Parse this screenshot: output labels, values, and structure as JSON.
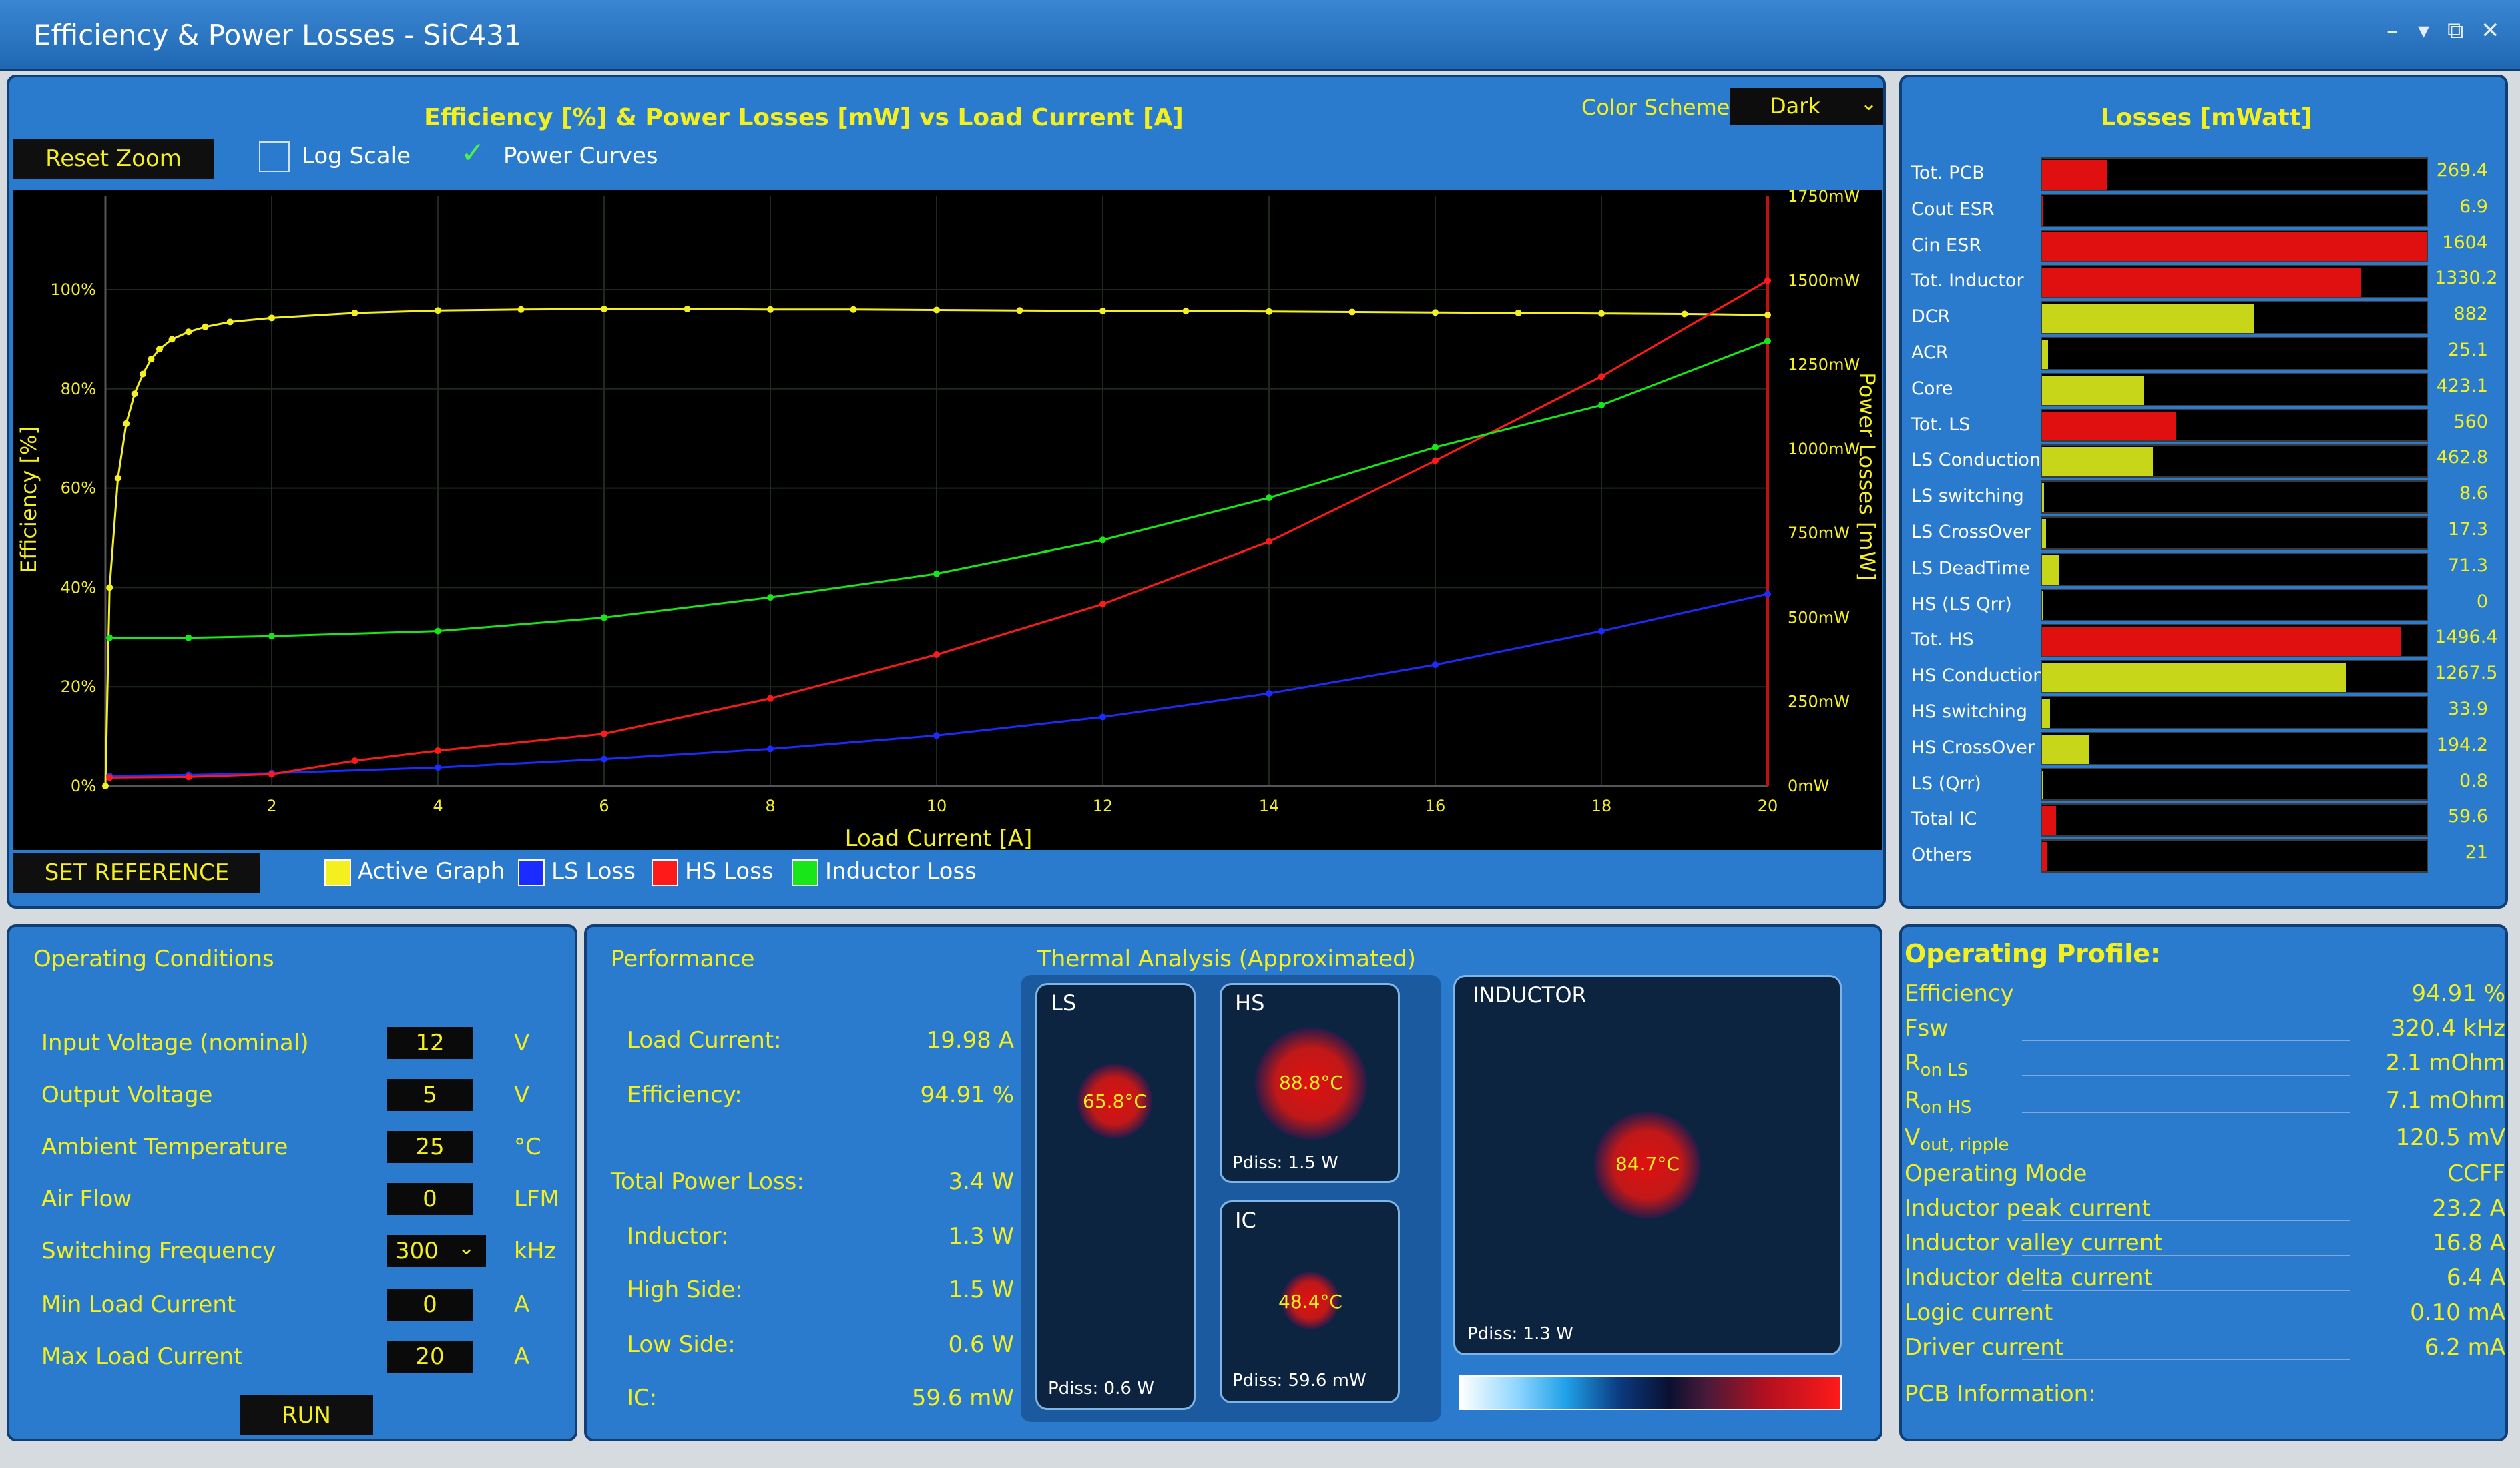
{
  "window": {
    "title": "Efficiency & Power Losses - SiC431",
    "controls": [
      "–",
      "▾",
      "⧉",
      "✕"
    ]
  },
  "chart_panel": {
    "title": "Efficiency [%] & Power Losses [mW] vs Load Current [A]",
    "reset_zoom": "Reset Zoom",
    "log_scale_label": "Log Scale",
    "log_scale_checked": false,
    "power_curves_label": "Power Curves",
    "power_curves_checked": true,
    "color_scheme_label": "Color Scheme",
    "color_scheme_value": "Dark",
    "set_reference": "SET REFERENCE",
    "legend": [
      {
        "label": "Active Graph",
        "color": "#f4f020"
      },
      {
        "label": "LS Loss",
        "color": "#1a2cff"
      },
      {
        "label": "HS Loss",
        "color": "#ff1a1a"
      },
      {
        "label": "Inductor Loss",
        "color": "#19e619"
      }
    ]
  },
  "chart_data": {
    "type": "line",
    "title": "Efficiency [%] & Power Losses [mW] vs Load Current [A]",
    "xlabel": "Load Current [A]",
    "ylabel_left": "Efficiency [%]",
    "ylabel_right": "Power Losses [mW]",
    "xlim": [
      0,
      20
    ],
    "ylim_left": [
      0,
      100
    ],
    "ylim_right": [
      0,
      1750
    ],
    "x_ticks": [
      "2",
      "4",
      "6",
      "8",
      "10",
      "12",
      "14",
      "16",
      "18",
      "20"
    ],
    "y_left_ticks": [
      "0%",
      "20%",
      "40%",
      "60%",
      "80%",
      "100%"
    ],
    "y_right_ticks": [
      "0mW",
      "250mW",
      "500mW",
      "750mW",
      "1000mW",
      "1250mW",
      "1500mW",
      "1750mW"
    ],
    "grid": true,
    "series": [
      {
        "name": "Active Graph",
        "axis": "left",
        "color": "#f4f020",
        "points": [
          [
            0.0,
            0
          ],
          [
            0.05,
            40
          ],
          [
            0.15,
            62
          ],
          [
            0.25,
            73
          ],
          [
            0.35,
            79
          ],
          [
            0.45,
            83
          ],
          [
            0.55,
            86
          ],
          [
            0.65,
            88
          ],
          [
            0.8,
            90
          ],
          [
            1.0,
            91.5
          ],
          [
            1.2,
            92.5
          ],
          [
            1.5,
            93.5
          ],
          [
            2.0,
            94.3
          ],
          [
            3,
            95.3
          ],
          [
            4,
            95.8
          ],
          [
            5,
            96.0
          ],
          [
            6,
            96.1
          ],
          [
            7,
            96.1
          ],
          [
            8,
            96.0
          ],
          [
            9,
            96.0
          ],
          [
            10,
            95.9
          ],
          [
            11,
            95.8
          ],
          [
            12,
            95.7
          ],
          [
            13,
            95.7
          ],
          [
            14,
            95.6
          ],
          [
            15,
            95.5
          ],
          [
            16,
            95.4
          ],
          [
            17,
            95.3
          ],
          [
            18,
            95.2
          ],
          [
            19,
            95.1
          ],
          [
            20,
            94.9
          ]
        ]
      },
      {
        "name": "LS Loss",
        "axis": "right",
        "color": "#1a2cff",
        "points": [
          [
            0.05,
            30
          ],
          [
            1,
            33
          ],
          [
            2,
            38
          ],
          [
            4,
            55
          ],
          [
            6,
            80
          ],
          [
            8,
            110
          ],
          [
            10,
            150
          ],
          [
            12,
            205
          ],
          [
            14,
            275
          ],
          [
            16,
            360
          ],
          [
            18,
            460
          ],
          [
            20,
            570
          ]
        ]
      },
      {
        "name": "HS Loss",
        "axis": "right",
        "color": "#ff1a1a",
        "points": [
          [
            0.05,
            25
          ],
          [
            1,
            27
          ],
          [
            2,
            35
          ],
          [
            3,
            75
          ],
          [
            4,
            105
          ],
          [
            6,
            155
          ],
          [
            8,
            260
          ],
          [
            10,
            390
          ],
          [
            12,
            540
          ],
          [
            14,
            725
          ],
          [
            16,
            965
          ],
          [
            18,
            1215
          ],
          [
            20,
            1500
          ]
        ]
      },
      {
        "name": "Inductor Loss",
        "axis": "right",
        "color": "#19e619",
        "points": [
          [
            0.05,
            440
          ],
          [
            1,
            440
          ],
          [
            2,
            445
          ],
          [
            4,
            460
          ],
          [
            6,
            500
          ],
          [
            8,
            560
          ],
          [
            10,
            630
          ],
          [
            12,
            730
          ],
          [
            14,
            855
          ],
          [
            16,
            1005
          ],
          [
            18,
            1130
          ],
          [
            20,
            1320
          ]
        ]
      }
    ]
  },
  "losses_panel": {
    "title": "Losses [mWatt]",
    "max_value": 1604,
    "items": [
      {
        "label": "Tot. PCB",
        "value": "269.4",
        "level": 269.4,
        "color": "#e01010"
      },
      {
        "label": "Cout ESR",
        "value": "6.9",
        "level": 6.9,
        "color": "#e01010"
      },
      {
        "label": "Cin ESR",
        "value": "1604",
        "level": 1604,
        "color": "#e01010"
      },
      {
        "label": "Tot. Inductor",
        "value": "1330.2",
        "level": 1330.2,
        "color": "#e01010"
      },
      {
        "label": "DCR",
        "value": "882",
        "level": 882,
        "color": "#c8d619"
      },
      {
        "label": "ACR",
        "value": "25.1",
        "level": 25.1,
        "color": "#c8d619"
      },
      {
        "label": "Core",
        "value": "423.1",
        "level": 423.1,
        "color": "#c8d619"
      },
      {
        "label": "Tot. LS",
        "value": "560",
        "level": 560,
        "color": "#e01010"
      },
      {
        "label": "LS Conduction",
        "value": "462.8",
        "level": 462.8,
        "color": "#c8d619"
      },
      {
        "label": "LS switching",
        "value": "8.6",
        "level": 8.6,
        "color": "#c8d619"
      },
      {
        "label": "LS CrossOver",
        "value": "17.3",
        "level": 17.3,
        "color": "#c8d619"
      },
      {
        "label": "LS DeadTime",
        "value": "71.3",
        "level": 71.3,
        "color": "#c8d619"
      },
      {
        "label": "HS (LS Qrr)",
        "value": "0",
        "level": 0,
        "color": "#c8d619"
      },
      {
        "label": "Tot. HS",
        "value": "1496.4",
        "level": 1496.4,
        "color": "#e01010"
      },
      {
        "label": "HS Conduction",
        "value": "1267.5",
        "level": 1267.5,
        "color": "#c8d619"
      },
      {
        "label": "HS switching",
        "value": "33.9",
        "level": 33.9,
        "color": "#c8d619"
      },
      {
        "label": "HS CrossOver",
        "value": "194.2",
        "level": 194.2,
        "color": "#c8d619"
      },
      {
        "label": "LS (Qrr)",
        "value": "0.8",
        "level": 0.8,
        "color": "#c8d619"
      },
      {
        "label": "Total IC",
        "value": "59.6",
        "level": 59.6,
        "color": "#e01010"
      },
      {
        "label": "Others",
        "value": "21",
        "level": 21,
        "color": "#e01010"
      }
    ]
  },
  "operating_conditions": {
    "title": "Operating Conditions",
    "rows": [
      {
        "label": "Input Voltage (nominal)",
        "value": "12",
        "unit": "V"
      },
      {
        "label": "Output Voltage",
        "value": "5",
        "unit": "V"
      },
      {
        "label": "Ambient Temperature",
        "value": "25",
        "unit": "°C"
      },
      {
        "label": "Air Flow",
        "value": "0",
        "unit": "LFM"
      },
      {
        "label": "Switching Frequency",
        "value": "300",
        "unit": "kHz"
      },
      {
        "label": "Min Load Current",
        "value": "0",
        "unit": "A"
      },
      {
        "label": "Max Load Current",
        "value": "20",
        "unit": "A"
      }
    ],
    "run": "RUN"
  },
  "performance": {
    "title": "Performance",
    "rows": [
      {
        "label": "Load Current:",
        "value": "19.98 A"
      },
      {
        "label": "Efficiency:",
        "value": "94.91 %"
      },
      {
        "label": "Total Power Loss:",
        "value": "3.4 W"
      },
      {
        "label": "Inductor:",
        "value": "1.3 W"
      },
      {
        "label": "High Side:",
        "value": "1.5 W"
      },
      {
        "label": "Low Side:",
        "value": "0.6 W"
      },
      {
        "label": "IC:",
        "value": "59.6 mW"
      }
    ]
  },
  "thermal": {
    "title": "Thermal Analysis (Approximated)",
    "ls": {
      "name": "LS",
      "temp": "65.8°C",
      "pdiss": "Pdiss: 0.6 W"
    },
    "hs": {
      "name": "HS",
      "temp": "88.8°C",
      "pdiss": "Pdiss: 1.5 W"
    },
    "ic": {
      "name": "IC",
      "temp": "48.4°C",
      "pdiss": "Pdiss: 59.6 mW"
    },
    "inductor": {
      "name": "INDUCTOR",
      "temp": "84.7°C",
      "pdiss": "Pdiss: 1.3 W"
    }
  },
  "operating_profile": {
    "title": "Operating Profile:",
    "rows": [
      {
        "label": "Efficiency",
        "sub": "",
        "value": "94.91 %"
      },
      {
        "label": "Fsw",
        "sub": "",
        "value": "320.4 kHz"
      },
      {
        "label": "R",
        "sub": "on LS",
        "value": "2.1 mOhm"
      },
      {
        "label": "R",
        "sub": "on HS",
        "value": "7.1 mOhm"
      },
      {
        "label": "V",
        "sub": "out, ripple",
        "value": "120.5 mV"
      },
      {
        "label": "Operating Mode",
        "sub": "",
        "value": "CCFF"
      },
      {
        "label": "Inductor peak current",
        "sub": "",
        "value": "23.2 A"
      },
      {
        "label": "Inductor valley current",
        "sub": "",
        "value": "16.8 A"
      },
      {
        "label": "Inductor delta current",
        "sub": "",
        "value": "6.4 A"
      },
      {
        "label": "Logic current",
        "sub": "",
        "value": "0.10 mA"
      },
      {
        "label": "Driver current",
        "sub": "",
        "value": "6.2 mA"
      }
    ],
    "pcb_info": "PCB Information:"
  }
}
